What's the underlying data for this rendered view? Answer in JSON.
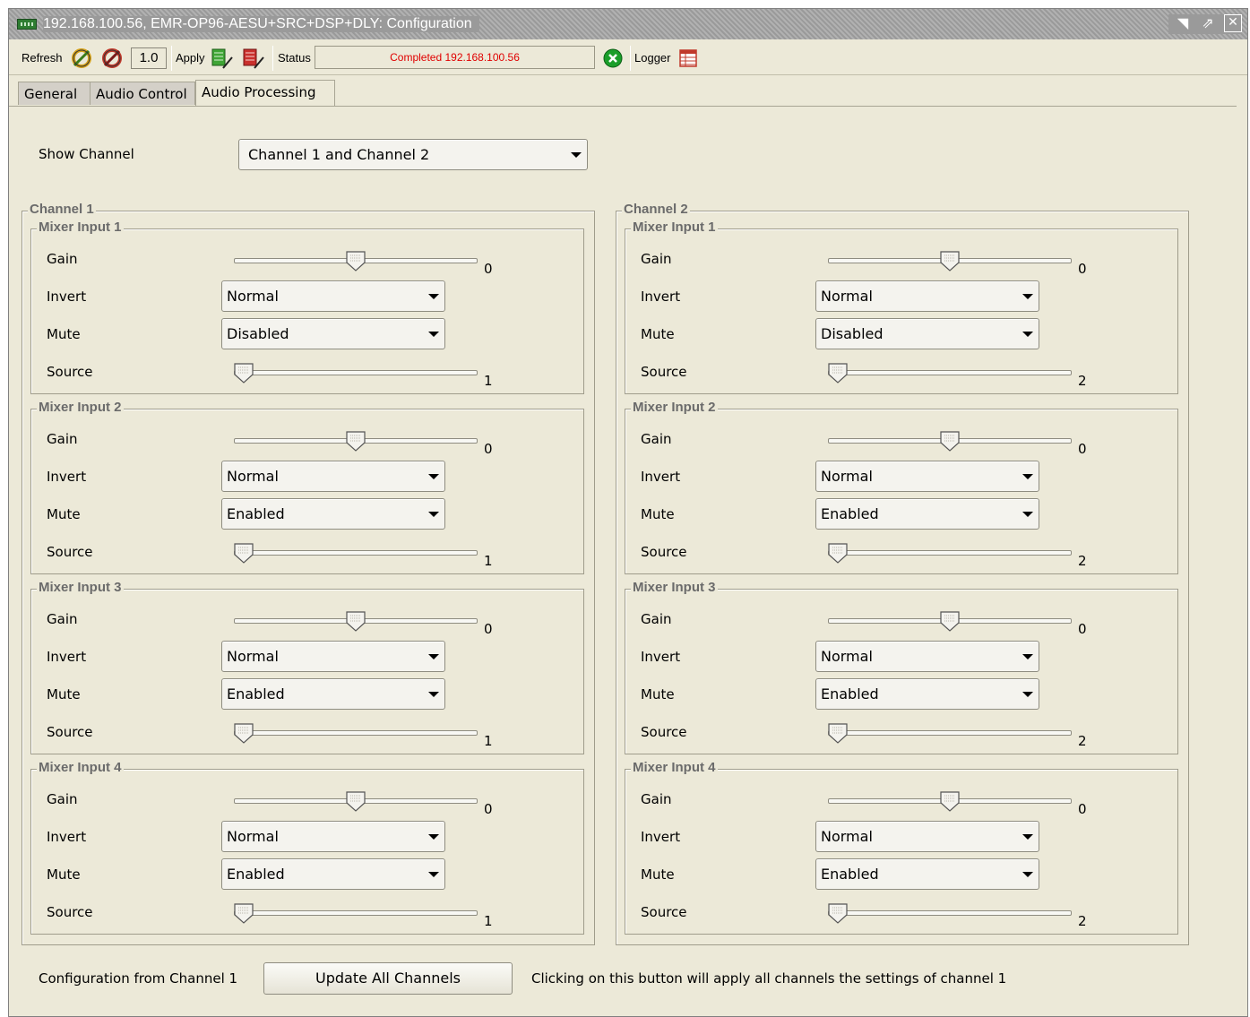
{
  "window": {
    "title": "192.168.100.56, EMR-OP96-AESU+SRC+DSP+DLY: Configuration"
  },
  "toolbar": {
    "refresh_label": "Refresh",
    "version_value": "1.0",
    "apply_label": "Apply",
    "status_label": "Status",
    "status_text": "Completed 192.168.100.56",
    "logger_label": "Logger",
    "status_color": "#e00000"
  },
  "tabs": [
    {
      "label": "General"
    },
    {
      "label": "Audio Control"
    },
    {
      "label": "Audio Processing"
    }
  ],
  "show_channel": {
    "label": "Show Channel",
    "value": "Channel 1 and Channel 2"
  },
  "field_labels": {
    "gain": "Gain",
    "invert": "Invert",
    "mute": "Mute",
    "source": "Source"
  },
  "channels": [
    {
      "title": "Channel 1",
      "mixers": [
        {
          "title": "Mixer Input 1",
          "gain": "0",
          "gain_level": 0.5,
          "invert": "Normal",
          "mute": "Disabled",
          "source": "1",
          "source_level": 0.0
        },
        {
          "title": "Mixer Input 2",
          "gain": "0",
          "gain_level": 0.5,
          "invert": "Normal",
          "mute": "Enabled",
          "source": "1",
          "source_level": 0.0
        },
        {
          "title": "Mixer Input 3",
          "gain": "0",
          "gain_level": 0.5,
          "invert": "Normal",
          "mute": "Enabled",
          "source": "1",
          "source_level": 0.0
        },
        {
          "title": "Mixer Input 4",
          "gain": "0",
          "gain_level": 0.5,
          "invert": "Normal",
          "mute": "Enabled",
          "source": "1",
          "source_level": 0.0
        }
      ]
    },
    {
      "title": "Channel 2",
      "mixers": [
        {
          "title": "Mixer Input 1",
          "gain": "0",
          "gain_level": 0.5,
          "invert": "Normal",
          "mute": "Disabled",
          "source": "2",
          "source_level": 0.0
        },
        {
          "title": "Mixer Input 2",
          "gain": "0",
          "gain_level": 0.5,
          "invert": "Normal",
          "mute": "Enabled",
          "source": "2",
          "source_level": 0.0
        },
        {
          "title": "Mixer Input 3",
          "gain": "0",
          "gain_level": 0.5,
          "invert": "Normal",
          "mute": "Enabled",
          "source": "2",
          "source_level": 0.0
        },
        {
          "title": "Mixer Input 4",
          "gain": "0",
          "gain_level": 0.5,
          "invert": "Normal",
          "mute": "Enabled",
          "source": "2",
          "source_level": 0.0
        }
      ]
    }
  ],
  "footer": {
    "config_label": "Configuration from Channel 1",
    "update_button": "Update All Channels",
    "help_text": "Clicking on this button will apply all channels the settings of channel 1"
  }
}
